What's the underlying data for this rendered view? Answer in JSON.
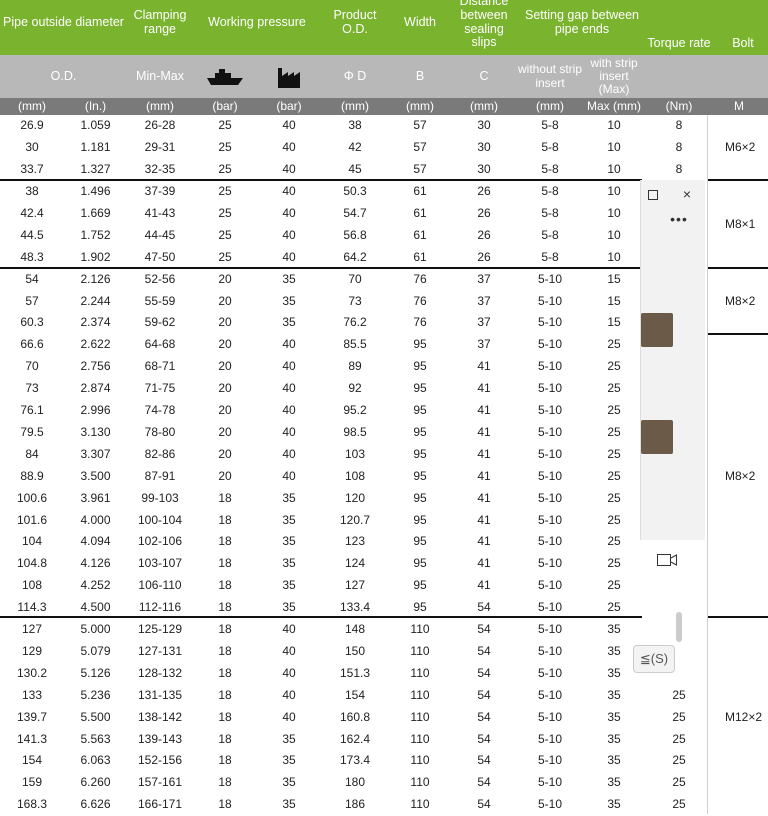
{
  "header": {
    "pipe_od": "Pipe outside diameter",
    "clamping_range": "Clamping range",
    "working_pressure": "Working pressure",
    "product_od": "Product O.D.",
    "width": "Width",
    "distance": "Distance between sealing slips",
    "setting_gap": "Setting gap between pipe ends",
    "torque": "Torque rate",
    "bolt": "Bolt"
  },
  "subheader": {
    "od": "O.D.",
    "minmax": "Min-Max",
    "phi_d": "Φ D",
    "b": "B",
    "c": "C",
    "without": "without strip insert",
    "with": "with strip insert (Max)",
    "ship_icon": "ship-icon",
    "factory_icon": "factory-icon"
  },
  "units": [
    "(mm)",
    "(In.)",
    "(mm)",
    "(bar)",
    "(bar)",
    "(mm)",
    "(mm)",
    "(mm)",
    "(mm)",
    "Max (mm)",
    "(Nm)",
    "M"
  ],
  "rows": [
    [
      "26.9",
      "1.059",
      "26-28",
      "25",
      "40",
      "38",
      "57",
      "30",
      "5-8",
      "10",
      "8"
    ],
    [
      "30",
      "1.181",
      "29-31",
      "25",
      "40",
      "42",
      "57",
      "30",
      "5-8",
      "10",
      "8"
    ],
    [
      "33.7",
      "1.327",
      "32-35",
      "25",
      "40",
      "45",
      "57",
      "30",
      "5-8",
      "10",
      "8"
    ],
    [
      "38",
      "1.496",
      "37-39",
      "25",
      "40",
      "50.3",
      "61",
      "26",
      "5-8",
      "10",
      ""
    ],
    [
      "42.4",
      "1.669",
      "41-43",
      "25",
      "40",
      "54.7",
      "61",
      "26",
      "5-8",
      "10",
      ""
    ],
    [
      "44.5",
      "1.752",
      "44-45",
      "25",
      "40",
      "56.8",
      "61",
      "26",
      "5-8",
      "10",
      ""
    ],
    [
      "48.3",
      "1.902",
      "47-50",
      "25",
      "40",
      "64.2",
      "61",
      "26",
      "5-8",
      "10",
      ""
    ],
    [
      "54",
      "2.126",
      "52-56",
      "20",
      "35",
      "70",
      "76",
      "37",
      "5-10",
      "15",
      ""
    ],
    [
      "57",
      "2.244",
      "55-59",
      "20",
      "35",
      "73",
      "76",
      "37",
      "5-10",
      "15",
      ""
    ],
    [
      "60.3",
      "2.374",
      "59-62",
      "20",
      "35",
      "76.2",
      "76",
      "37",
      "5-10",
      "15",
      ""
    ],
    [
      "66.6",
      "2.622",
      "64-68",
      "20",
      "40",
      "85.5",
      "95",
      "37",
      "5-10",
      "25",
      ""
    ],
    [
      "70",
      "2.756",
      "68-71",
      "20",
      "40",
      "89",
      "95",
      "41",
      "5-10",
      "25",
      ""
    ],
    [
      "73",
      "2.874",
      "71-75",
      "20",
      "40",
      "92",
      "95",
      "41",
      "5-10",
      "25",
      ""
    ],
    [
      "76.1",
      "2.996",
      "74-78",
      "20",
      "40",
      "95.2",
      "95",
      "41",
      "5-10",
      "25",
      ""
    ],
    [
      "79.5",
      "3.130",
      "78-80",
      "20",
      "40",
      "98.5",
      "95",
      "41",
      "5-10",
      "25",
      ""
    ],
    [
      "84",
      "3.307",
      "82-86",
      "20",
      "40",
      "103",
      "95",
      "41",
      "5-10",
      "25",
      ""
    ],
    [
      "88.9",
      "3.500",
      "87-91",
      "20",
      "40",
      "108",
      "95",
      "41",
      "5-10",
      "25",
      ""
    ],
    [
      "100.6",
      "3.961",
      "99-103",
      "18",
      "35",
      "120",
      "95",
      "41",
      "5-10",
      "25",
      ""
    ],
    [
      "101.6",
      "4.000",
      "100-104",
      "18",
      "35",
      "120.7",
      "95",
      "41",
      "5-10",
      "25",
      ""
    ],
    [
      "104",
      "4.094",
      "102-106",
      "18",
      "35",
      "123",
      "95",
      "41",
      "5-10",
      "25",
      ""
    ],
    [
      "104.8",
      "4.126",
      "103-107",
      "18",
      "35",
      "124",
      "95",
      "41",
      "5-10",
      "25",
      ""
    ],
    [
      "108",
      "4.252",
      "106-110",
      "18",
      "35",
      "127",
      "95",
      "41",
      "5-10",
      "25",
      ""
    ],
    [
      "114.3",
      "4.500",
      "112-116",
      "18",
      "35",
      "133.4",
      "95",
      "54",
      "5-10",
      "25",
      ""
    ],
    [
      "127",
      "5.000",
      "125-129",
      "18",
      "40",
      "148",
      "110",
      "54",
      "5-10",
      "35",
      ""
    ],
    [
      "129",
      "5.079",
      "127-131",
      "18",
      "40",
      "150",
      "110",
      "54",
      "5-10",
      "35",
      ""
    ],
    [
      "130.2",
      "5.126",
      "128-132",
      "18",
      "40",
      "151.3",
      "110",
      "54",
      "5-10",
      "35",
      ""
    ],
    [
      "133",
      "5.236",
      "131-135",
      "18",
      "40",
      "154",
      "110",
      "54",
      "5-10",
      "35",
      "25"
    ],
    [
      "139.7",
      "5.500",
      "138-142",
      "18",
      "40",
      "160.8",
      "110",
      "54",
      "5-10",
      "35",
      "25"
    ],
    [
      "141.3",
      "5.563",
      "139-143",
      "18",
      "35",
      "162.4",
      "110",
      "54",
      "5-10",
      "35",
      "25"
    ],
    [
      "154",
      "6.063",
      "152-156",
      "18",
      "35",
      "173.4",
      "110",
      "54",
      "5-10",
      "35",
      "25"
    ],
    [
      "159",
      "6.260",
      "157-161",
      "18",
      "35",
      "180",
      "110",
      "54",
      "5-10",
      "35",
      "25"
    ],
    [
      "168.3",
      "6.626",
      "166-171",
      "18",
      "35",
      "186",
      "110",
      "54",
      "5-10",
      "35",
      "25"
    ]
  ],
  "bolts": [
    {
      "label": "M6×2",
      "row": 1
    },
    {
      "label": "M8×1",
      "row": 4.5
    },
    {
      "label": "M8×2",
      "row": 8
    },
    {
      "label": "M8×2",
      "row": 16
    },
    {
      "label": "M12×2",
      "row": 27
    }
  ],
  "overlay": {
    "restore_icon": "restore-icon",
    "close_icon": "close-icon",
    "more_icon": "more-icon",
    "video_icon": "video-icon",
    "send_text": "(S)",
    "send_prefix": "≦"
  }
}
